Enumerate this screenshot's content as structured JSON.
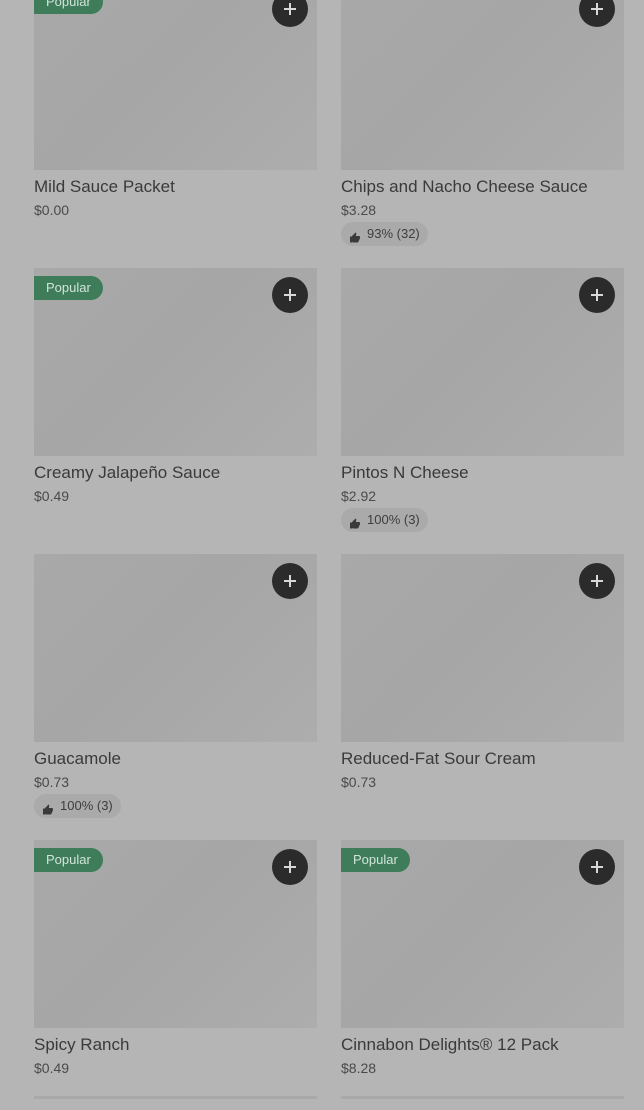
{
  "items": [
    {
      "name": "Mild Sauce Packet",
      "price": "$0.00",
      "badge": "Popular",
      "rating": ""
    },
    {
      "name": "Chips and Nacho Cheese Sauce",
      "price": "$3.28",
      "badge": "",
      "rating": "93% (32)"
    },
    {
      "name": "Creamy Jalapeño Sauce",
      "price": "$0.49",
      "badge": "Popular",
      "rating": ""
    },
    {
      "name": "Pintos N Cheese",
      "price": "$2.92",
      "badge": "",
      "rating": "100% (3)"
    },
    {
      "name": "Guacamole",
      "price": "$0.73",
      "badge": "",
      "rating": "100% (3)"
    },
    {
      "name": "Reduced-Fat Sour Cream",
      "price": "$0.73",
      "badge": "",
      "rating": ""
    },
    {
      "name": "Spicy Ranch",
      "price": "$0.49",
      "badge": "Popular",
      "rating": ""
    },
    {
      "name": "Cinnabon Delights® 12 Pack",
      "price": "$8.28",
      "badge": "Popular",
      "rating": ""
    }
  ],
  "icons": {
    "add": "plus-icon",
    "rating": "thumbs-up-icon"
  },
  "colors": {
    "badge_bg": "#3e7c5a",
    "add_button_bg": "#2b2b2b"
  }
}
